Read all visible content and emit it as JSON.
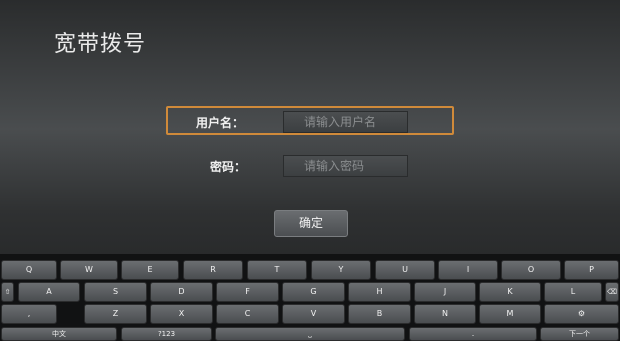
{
  "page": {
    "title": "宽带拨号"
  },
  "form": {
    "username_label": "用户名：",
    "username_placeholder": "请输入用户名",
    "password_label": "密码：",
    "password_placeholder": "请输入密码",
    "confirm_label": "确定"
  },
  "keyboard": {
    "row1": [
      "Q",
      "W",
      "E",
      "R",
      "T",
      "Y",
      "U",
      "I",
      "O",
      "P"
    ],
    "row2": [
      "A",
      "S",
      "D",
      "F",
      "G",
      "H",
      "J",
      "K",
      "L"
    ],
    "row3": [
      ",",
      "Z",
      "X",
      "C",
      "V",
      "B",
      "N",
      "M"
    ],
    "row4": {
      "lang": "中文",
      "symbols": "?123",
      "period": ".",
      "next": "下一个"
    },
    "icons": {
      "shift": "shift-icon",
      "delete": "delete-icon",
      "comma_alt": "comma-alt-icon",
      "space": "space-icon"
    }
  }
}
